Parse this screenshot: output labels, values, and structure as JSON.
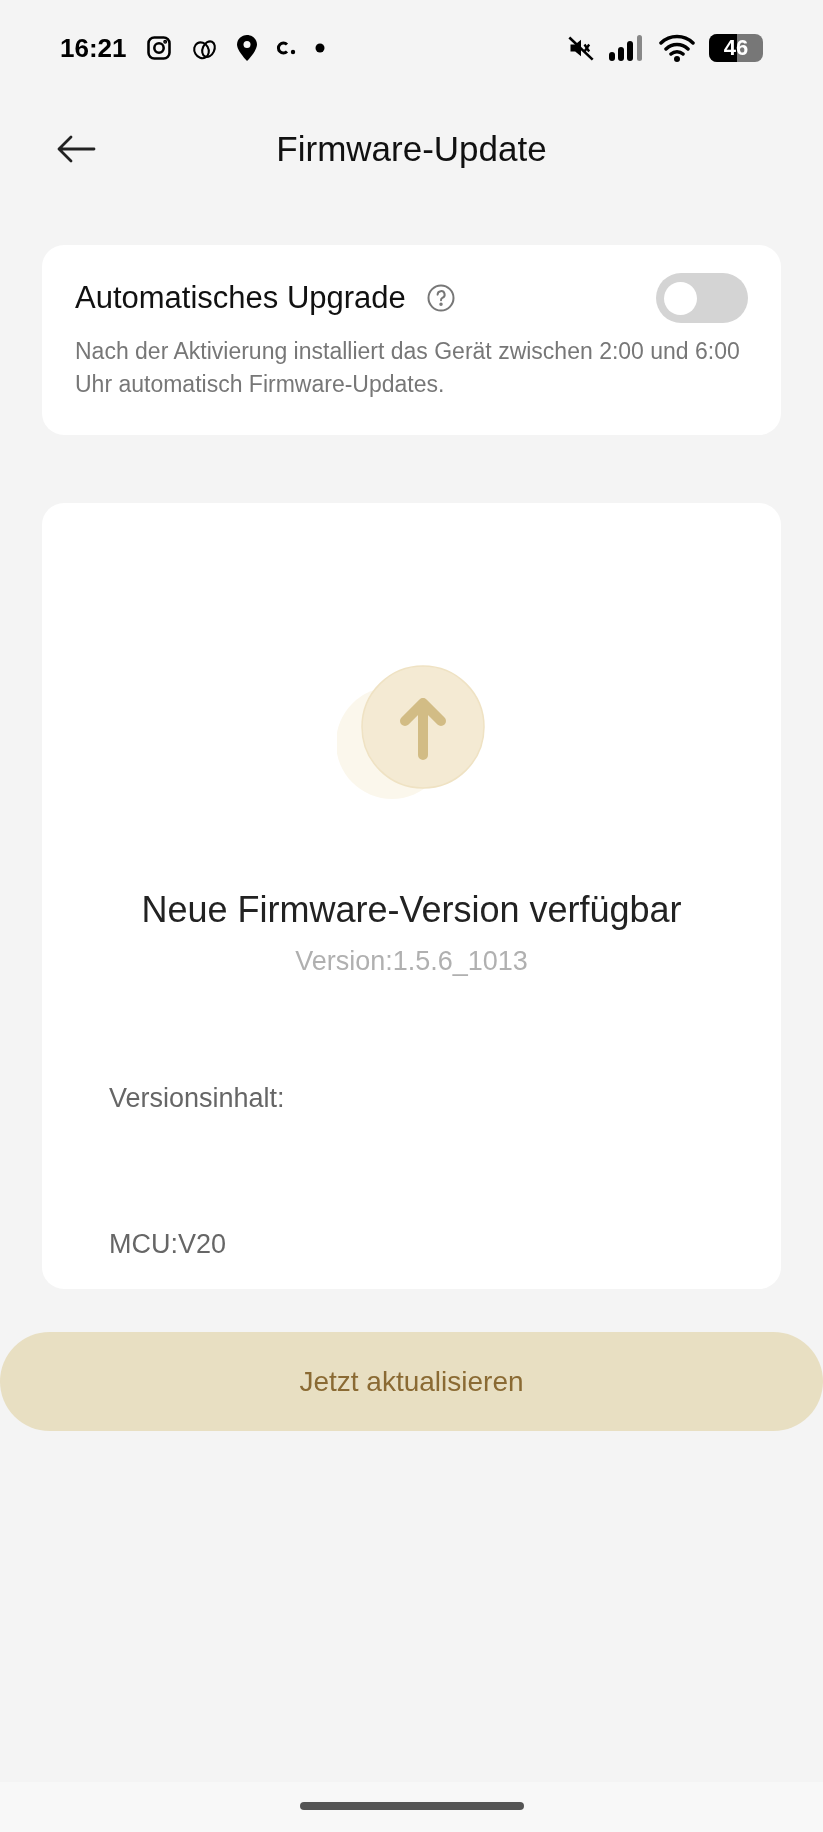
{
  "status_bar": {
    "time": "16:21",
    "battery": "46"
  },
  "header": {
    "title": "Firmware-Update"
  },
  "auto_upgrade": {
    "label": "Automatisches Upgrade",
    "on": false,
    "description": "Nach der Aktivierung installiert das Gerät zwischen 2:00 und 6:00 Uhr automatisch Firmware-Updates."
  },
  "firmware": {
    "title": "Neue Firmware-Version verfügbar",
    "version": "Version:1.5.6_1013",
    "content_label": "Versionsinhalt:",
    "content": "MCU:V20"
  },
  "update_button": {
    "label": "Jetzt aktualisieren"
  }
}
